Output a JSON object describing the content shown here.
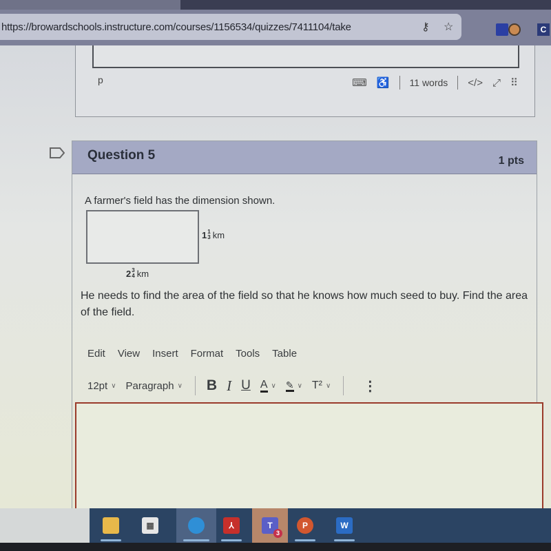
{
  "browser": {
    "url": "https://browardschools.instructure.com/courses/1156534/quizzes/7411104/take",
    "icons": [
      "key-icon",
      "favorite-star-icon"
    ],
    "extensions": [
      "extension-blue-icon",
      "extension-clock-icon",
      "extension-c-icon"
    ],
    "ext_c_label": "C"
  },
  "previous_editor": {
    "path_label": "p",
    "word_count": "11 words",
    "html_toggle": "</>",
    "status_icons": [
      "keyboard-icon",
      "accessibility-icon",
      "html-code-icon",
      "fullscreen-icon",
      "drag-handle-icon"
    ]
  },
  "question": {
    "title": "Question 5",
    "points": "1 pts",
    "intro": "A farmer's field has the dimension shown.",
    "figure": {
      "height_whole": "1",
      "height_num": "1",
      "height_den": "3",
      "width_whole": "2",
      "width_num": "3",
      "width_den": "4",
      "unit": "km"
    },
    "prompt": "He needs to find the area of the field so that he knows how much seed to buy. Find the area of the field."
  },
  "editor": {
    "menu": [
      "Edit",
      "View",
      "Insert",
      "Format",
      "Tools",
      "Table"
    ],
    "font_size": "12pt",
    "block_format": "Paragraph",
    "bold": "B",
    "italic": "I",
    "underline": "U",
    "font_color": "A",
    "superscript": "T²",
    "more": "⋮",
    "content": ""
  },
  "taskbar": {
    "apps": [
      {
        "name": "File Explorer",
        "label": "",
        "color": "#e8b84a"
      },
      {
        "name": "Microsoft Store",
        "label": "",
        "color": "#e6e6e6"
      },
      {
        "name": "Microsoft Edge",
        "label": "",
        "color": "#2f8fd6"
      },
      {
        "name": "Adobe Acrobat",
        "label": "",
        "color": "#c6302b"
      },
      {
        "name": "Microsoft Teams",
        "label": "T",
        "badge": "3",
        "color": "#5b5fc7"
      },
      {
        "name": "PowerPoint",
        "label": "P",
        "color": "#d2572f"
      },
      {
        "name": "Word",
        "label": "W",
        "color": "#2b6cc4"
      }
    ]
  }
}
